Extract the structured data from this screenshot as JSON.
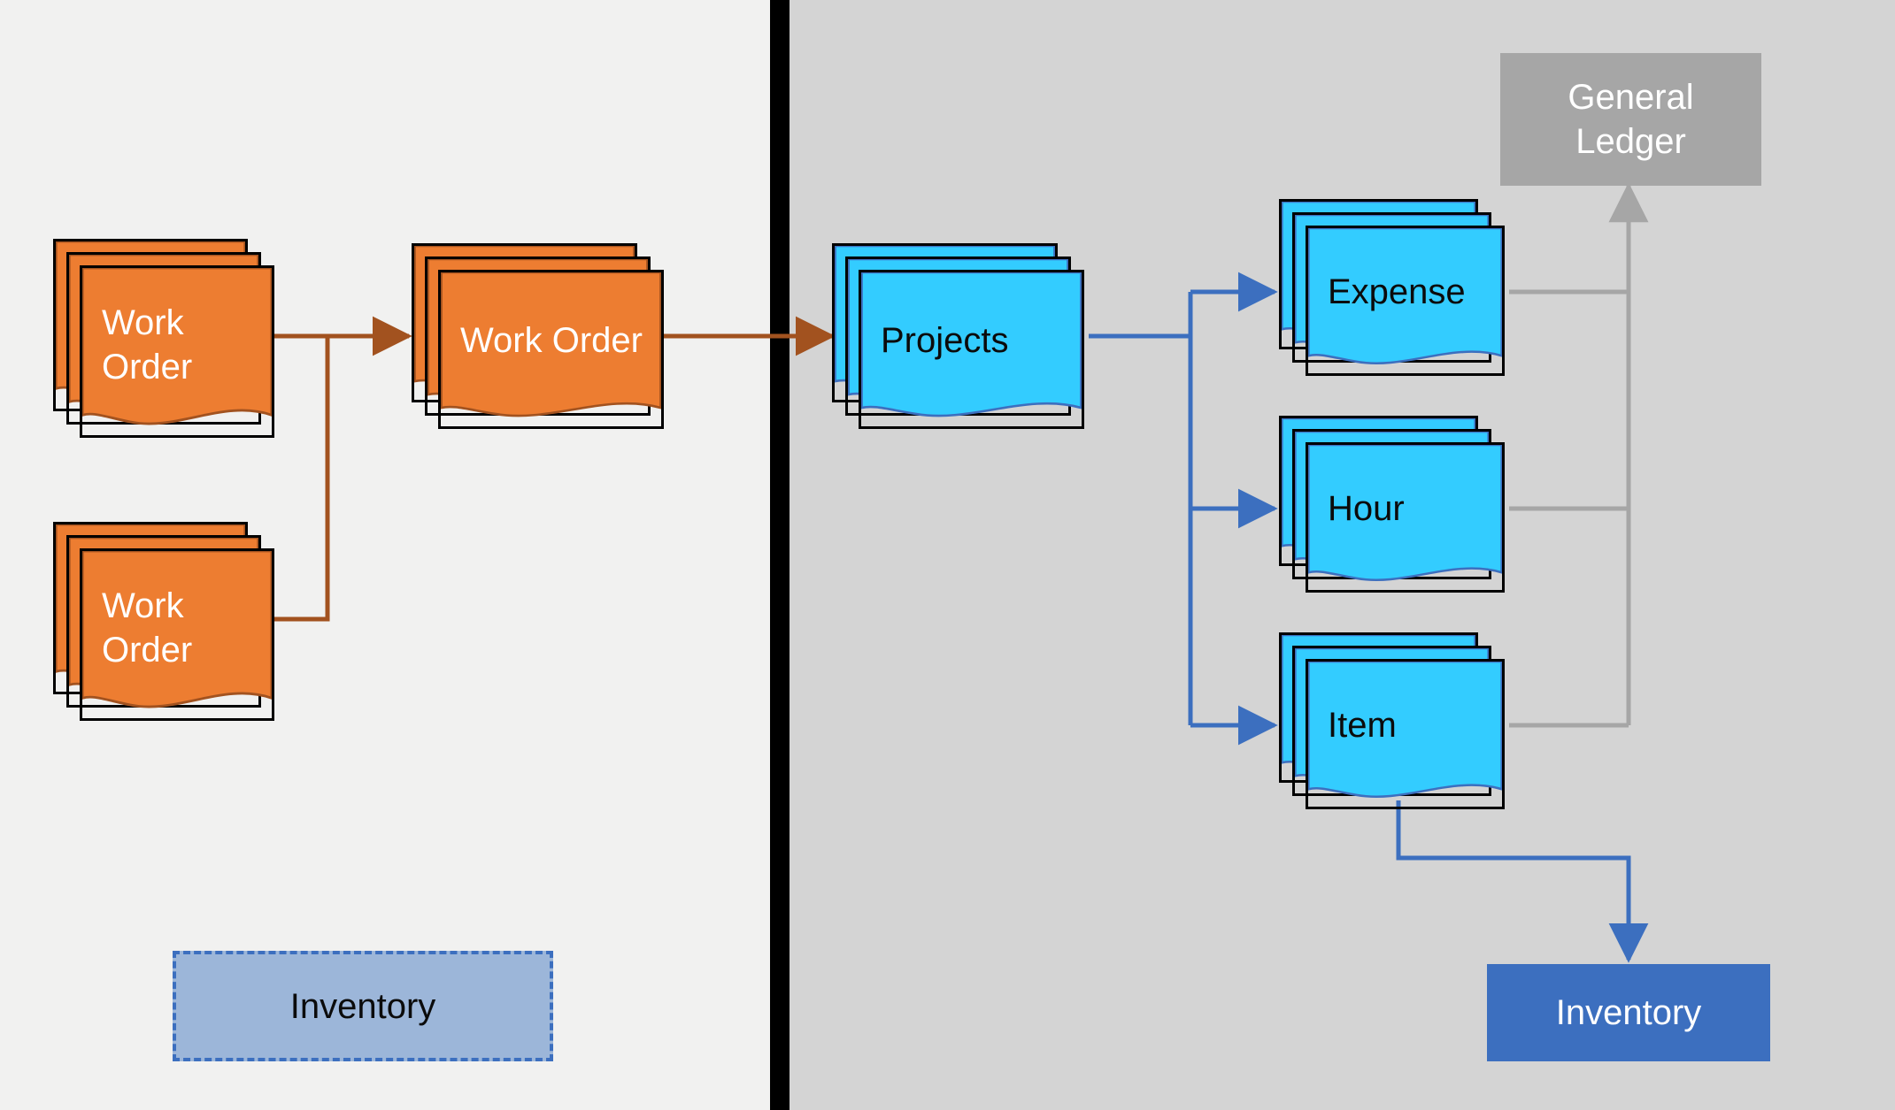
{
  "colors": {
    "orange_fill": "#ed7d31",
    "orange_stroke": "#a2521f",
    "cyan_fill": "#33ccff",
    "cyan_stroke": "#3c6fbf",
    "gray_box": "#a6a6a6",
    "blue_box": "#3c6fbf",
    "dashed_bg": "#9cb6d9",
    "arrow_orange": "#a2521f",
    "arrow_blue": "#3c6fbf",
    "arrow_gray": "#a6a6a6"
  },
  "left": {
    "work_order_top": "Work Order",
    "work_order_bottom": "Work Order",
    "work_order_mid": "Work Order",
    "inventory_dashed": "Inventory"
  },
  "right": {
    "projects": "Projects",
    "expense": "Expense",
    "hour": "Hour",
    "item": "Item",
    "general_ledger": "General Ledger",
    "inventory": "Inventory"
  },
  "diagram": {
    "nodes": [
      {
        "id": "wo_top",
        "type": "doc-stack",
        "color": "orange",
        "label_path": "left.work_order_top"
      },
      {
        "id": "wo_bottom",
        "type": "doc-stack",
        "color": "orange",
        "label_path": "left.work_order_bottom"
      },
      {
        "id": "wo_mid",
        "type": "doc-stack",
        "color": "orange",
        "label_path": "left.work_order_mid"
      },
      {
        "id": "projects",
        "type": "doc-stack",
        "color": "cyan",
        "label_path": "right.projects"
      },
      {
        "id": "expense",
        "type": "doc-stack",
        "color": "cyan",
        "label_path": "right.expense"
      },
      {
        "id": "hour",
        "type": "doc-stack",
        "color": "cyan",
        "label_path": "right.hour"
      },
      {
        "id": "item",
        "type": "doc-stack",
        "color": "cyan",
        "label_path": "right.item"
      },
      {
        "id": "gl",
        "type": "box",
        "color": "gray",
        "label_path": "right.general_ledger"
      },
      {
        "id": "inv_right",
        "type": "box",
        "color": "blue",
        "label_path": "right.inventory"
      },
      {
        "id": "inv_left",
        "type": "box-dashed",
        "color": "dashed",
        "label_path": "left.inventory_dashed"
      }
    ],
    "edges": [
      {
        "from": "wo_top",
        "to": "wo_mid",
        "color": "orange",
        "arrow": true
      },
      {
        "from": "wo_bottom",
        "to": "wo_mid",
        "color": "orange",
        "arrow": false,
        "merge": true
      },
      {
        "from": "wo_mid",
        "to": "projects",
        "color": "orange",
        "arrow": true
      },
      {
        "from": "projects",
        "to": "expense",
        "color": "blue",
        "arrow": true
      },
      {
        "from": "projects",
        "to": "hour",
        "color": "blue",
        "arrow": true
      },
      {
        "from": "projects",
        "to": "item",
        "color": "blue",
        "arrow": true
      },
      {
        "from": "expense",
        "to": "gl",
        "color": "gray",
        "arrow": true
      },
      {
        "from": "hour",
        "to": "gl",
        "color": "gray",
        "arrow": false,
        "merge": true
      },
      {
        "from": "item",
        "to": "gl",
        "color": "gray",
        "arrow": false,
        "merge": true
      },
      {
        "from": "item",
        "to": "inv_right",
        "color": "blue",
        "arrow": true
      }
    ]
  }
}
